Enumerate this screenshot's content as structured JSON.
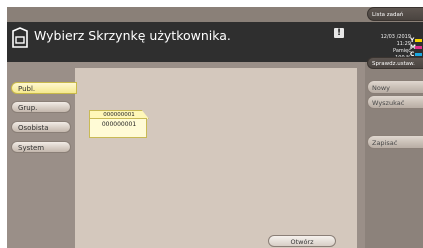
{
  "header": {
    "title": "Wybierz Skrzynkę użytkownika.",
    "box_icon": "user-box-icon",
    "alert_icon": "!"
  },
  "status": {
    "date": "12/03 /2019",
    "time": "11:29",
    "memory_label": "Pamięć",
    "memory_value": "100 %"
  },
  "toner": [
    {
      "letter": "Y",
      "color": "#f5d400"
    },
    {
      "letter": "M",
      "color": "#e0308c"
    },
    {
      "letter": "C",
      "color": "#1aa7e0"
    },
    {
      "letter": "K",
      "color": "#1a1a1a"
    }
  ],
  "right_buttons": {
    "job_list": "Lista zadań",
    "check_settings": "Sprawdz.ustaw.",
    "new": "Nowy",
    "search": "Wyszukać",
    "save": "Zapisać"
  },
  "tabs": [
    "Publ.",
    "Grup.",
    "Osobista",
    "System"
  ],
  "active_tab": "Publ.",
  "box": {
    "number": "000000001",
    "name": "000000001"
  },
  "open_button": "Otwórz",
  "colors": {
    "accent_yellow": "#fff7b8",
    "header_bg": "#2f2f2f",
    "panel_bg": "#d4c8bd"
  }
}
